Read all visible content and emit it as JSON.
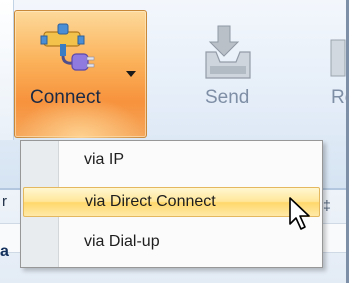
{
  "toolbar": {
    "connect_label": "Connect",
    "send_label": "Send",
    "next_label_partial": "Re"
  },
  "connect_menu": {
    "items": [
      {
        "label": "via IP"
      },
      {
        "label": "via Direct Connect",
        "highlighted": true
      },
      {
        "label": "via Dial-up"
      }
    ]
  },
  "background": {
    "peek_left_top": "r",
    "peek_left_bottom": "a",
    "peek_right": "‡"
  },
  "colors": {
    "connect_button_orange": "#f7923d",
    "menu_highlight": "#ffe79a",
    "ribbon_blue": "#e4edf8"
  },
  "icons": {
    "connect": "network-plug-icon",
    "send": "send-tray-icon",
    "dropdown": "caret-down-icon",
    "pointer": "mouse-pointer-icon"
  }
}
